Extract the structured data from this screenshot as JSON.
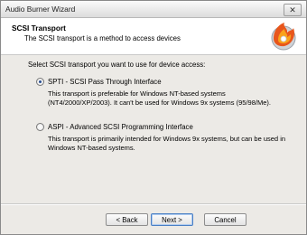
{
  "window": {
    "title": "Audio Burner Wizard",
    "close_glyph": "✕"
  },
  "header": {
    "title": "SCSI Transport",
    "subtitle": "The SCSI transport is a method to access devices",
    "logo_icon": "flame-disc-icon"
  },
  "main": {
    "intro": "Select SCSI transport you want to use for device access:",
    "options": [
      {
        "label": "SPTI - SCSI Pass Through Interface",
        "checked": true,
        "description_lines": [
          "This transport is preferable for Windows NT-based systems",
          "(NT4/2000/XP/2003). It can't be used for Windows 9x systems (95/98/Me)."
        ]
      },
      {
        "label": "ASPI - Advanced SCSI Programming Interface",
        "checked": false,
        "description_lines": [
          "This transport is primarily intended for Windows 9x systems, but can be used in",
          "Windows NT-based systems."
        ]
      }
    ]
  },
  "buttons": {
    "back": "< Back",
    "next": "Next >",
    "cancel": "Cancel"
  }
}
